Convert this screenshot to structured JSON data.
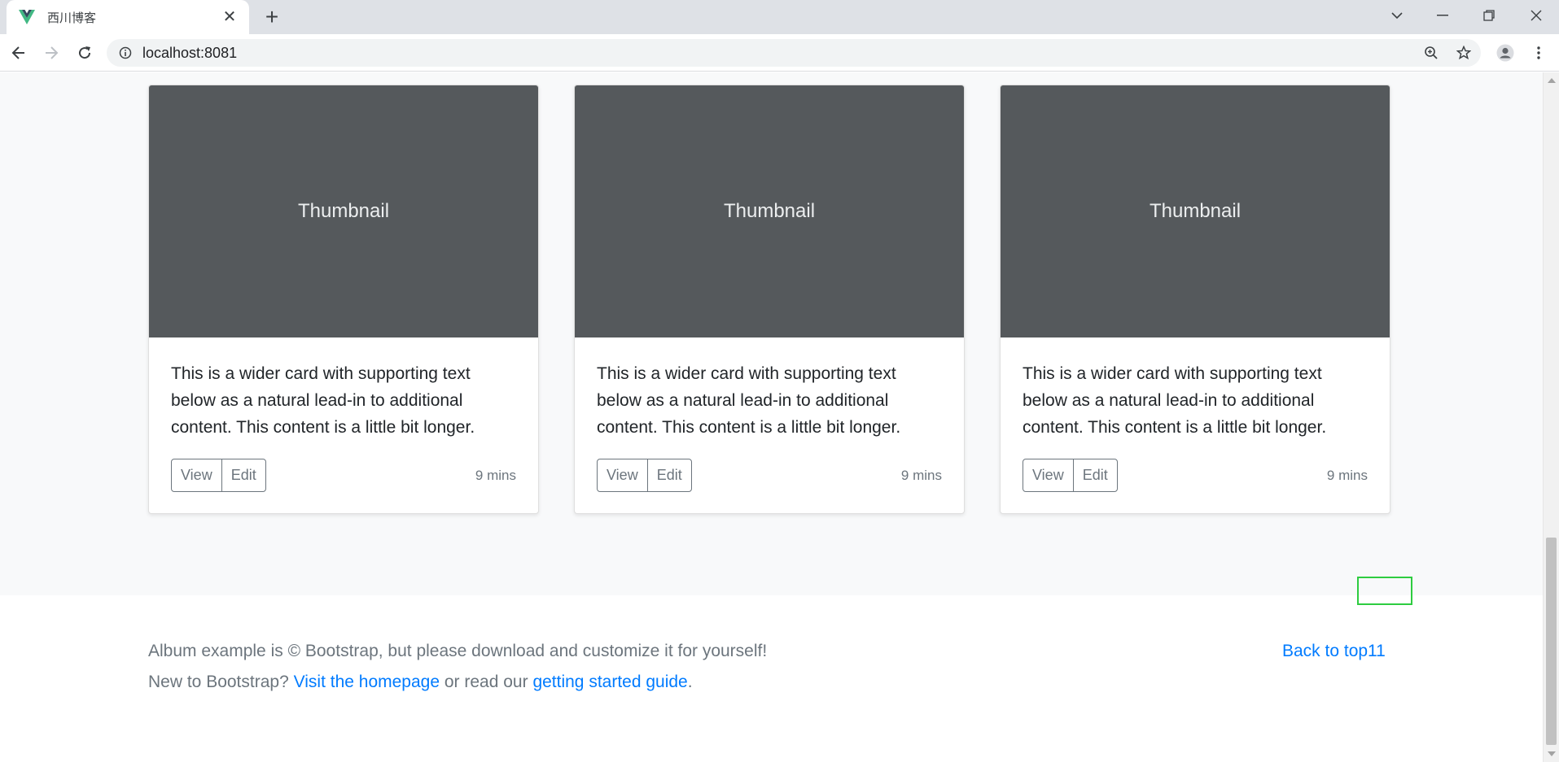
{
  "browser": {
    "tab_title": "西川博客",
    "url": "localhost:8081",
    "accent": "#41b883"
  },
  "cards": [
    {
      "thumbnail": "Thumbnail",
      "text": "This is a wider card with supporting text below as a natural lead-in to additional content. This content is a little bit longer.",
      "view_label": "View",
      "edit_label": "Edit",
      "time": "9 mins"
    },
    {
      "thumbnail": "Thumbnail",
      "text": "This is a wider card with supporting text below as a natural lead-in to additional content. This content is a little bit longer.",
      "view_label": "View",
      "edit_label": "Edit",
      "time": "9 mins"
    },
    {
      "thumbnail": "Thumbnail",
      "text": "This is a wider card with supporting text below as a natural lead-in to additional content. This content is a little bit longer.",
      "view_label": "View",
      "edit_label": "Edit",
      "time": "9 mins"
    }
  ],
  "footer": {
    "copyright": "Album example is © Bootstrap, but please download and customize it for yourself!",
    "new_to": "New to Bootstrap?",
    "homepage_link": "Visit the homepage",
    "or_read": "or read our",
    "guide_link": "getting started guide",
    "period": ".",
    "back_to_top": "Back to top11"
  },
  "colors": {
    "link": "#007bff",
    "thumbnail_bg": "#55595c",
    "highlight": "#2ecc40"
  }
}
